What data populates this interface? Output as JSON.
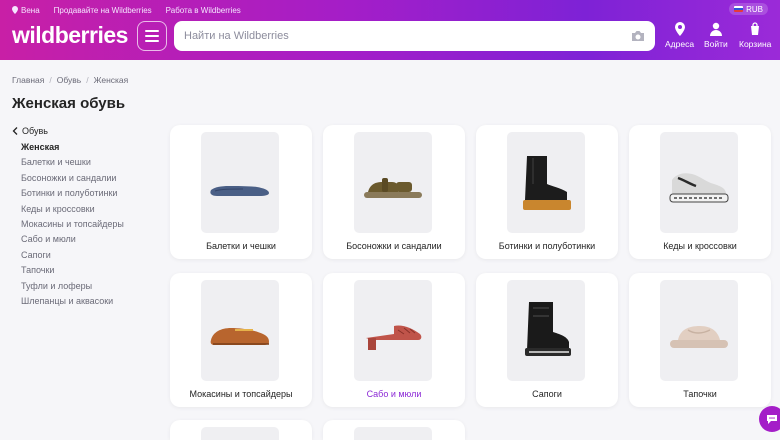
{
  "topbar": {
    "location": "Вена",
    "sell_link": "Продавайте на Wildberries",
    "work_link": "Работа в Wildberries",
    "currency": "RUB"
  },
  "header": {
    "logo": "wildberries",
    "search_placeholder": "Найти на Wildberries",
    "addresses_label": "Адреса",
    "login_label": "Войти",
    "cart_label": "Корзина"
  },
  "breadcrumb": [
    "Главная",
    "Обувь",
    "Женская"
  ],
  "page_title": "Женская обувь",
  "sidebar": {
    "parent": "Обувь",
    "items": [
      {
        "label": "Женская",
        "active": true
      },
      {
        "label": "Балетки и чешки"
      },
      {
        "label": "Босоножки и сандалии"
      },
      {
        "label": "Ботинки и полуботинки"
      },
      {
        "label": "Кеды и кроссовки"
      },
      {
        "label": "Мокасины и топсайдеры"
      },
      {
        "label": "Сабо и мюли"
      },
      {
        "label": "Сапоги"
      },
      {
        "label": "Тапочки"
      },
      {
        "label": "Туфли и лоферы"
      },
      {
        "label": "Шлепанцы и аквасоки"
      }
    ]
  },
  "categories": [
    {
      "label": "Балетки и чешки",
      "icon": "ballet-flat-icon",
      "color": "#4a5f86"
    },
    {
      "label": "Босоножки и сандалии",
      "icon": "sandal-icon",
      "color": "#6b5a2e"
    },
    {
      "label": "Ботинки и полуботинки",
      "icon": "chelsea-boot-icon",
      "color": "#1c1c1c"
    },
    {
      "label": "Кеды и кроссовки",
      "icon": "sneaker-icon",
      "color": "#d9d9d9"
    },
    {
      "label": "Мокасины и топсайдеры",
      "icon": "moccasin-icon",
      "color": "#b8652e"
    },
    {
      "label": "Сабо и мюли",
      "icon": "mule-icon",
      "color": "#c0544a",
      "highlight": true
    },
    {
      "label": "Сапоги",
      "icon": "snow-boot-icon",
      "color": "#1a1a1a"
    },
    {
      "label": "Тапочки",
      "icon": "slipper-icon",
      "color": "#e2cfc2"
    }
  ],
  "colors": {
    "brand_gradient_start": "#c81fa6",
    "brand_gradient_end": "#7e22d6",
    "highlight_text": "#8c2ad6"
  }
}
